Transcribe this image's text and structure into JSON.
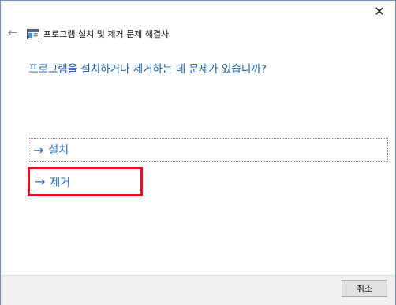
{
  "window": {
    "title": "프로그램 설치 및 제거 문제 해결사",
    "close_label": "✕",
    "back_label": "←"
  },
  "main": {
    "question": "프로그램을 설치하거나 제거하는 데 문제가 있습니까?",
    "options": [
      {
        "arrow": "→",
        "label": "설치"
      },
      {
        "arrow": "→",
        "label": "제거"
      }
    ]
  },
  "footer": {
    "cancel_label": "취소"
  },
  "colors": {
    "accent_text": "#1f5fa8",
    "highlight_border": "#e0121b"
  },
  "icons": {
    "back": "back-arrow-icon",
    "app": "troubleshooter-app-icon",
    "close": "close-icon",
    "option_arrow": "right-arrow-icon"
  }
}
